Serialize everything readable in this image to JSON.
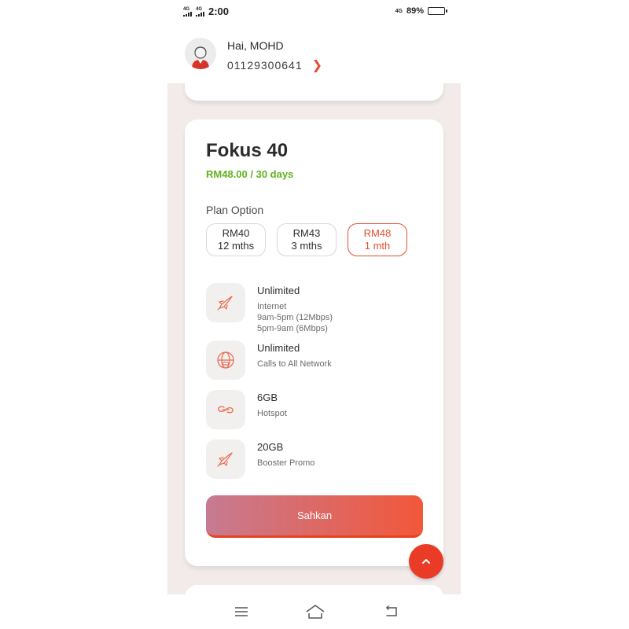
{
  "status_bar": {
    "signal1_type": "4G",
    "signal2_type": "4G",
    "time": "2:00",
    "network_right": "4G",
    "battery_percent": "89%",
    "battery_level": 0.89
  },
  "header": {
    "greeting": "Hai, MOHD",
    "phone_number": "01129300641"
  },
  "plan": {
    "title": "Fokus 40",
    "price": "RM48.00 / 30 days",
    "option_label": "Plan Option",
    "options": [
      {
        "price": "RM40",
        "duration": "12 mths",
        "selected": false
      },
      {
        "price": "RM43",
        "duration": "3 mths",
        "selected": false
      },
      {
        "price": "RM48",
        "duration": "1 mth",
        "selected": true
      }
    ],
    "features": [
      {
        "icon": "rocket-icon",
        "title": "Unlimited",
        "lines": [
          "Internet",
          "9am-5pm (12Mbps)",
          "5pm-9am (6Mbps)"
        ]
      },
      {
        "icon": "call-globe-icon",
        "title": "Unlimited",
        "lines": [
          "Calls to All Network"
        ]
      },
      {
        "icon": "hotspot-link-icon",
        "title": "6GB",
        "lines": [
          "Hotspot"
        ]
      },
      {
        "icon": "rocket-icon",
        "title": "20GB",
        "lines": [
          "Booster Promo"
        ]
      }
    ],
    "confirm_label": "Sahkan"
  },
  "colors": {
    "accent": "#e2502f",
    "price_green": "#62b21e",
    "fab": "#ea3b27",
    "background": "#f2ebea"
  },
  "nav_bar": [
    "menu-icon",
    "home-icon",
    "back-icon"
  ]
}
